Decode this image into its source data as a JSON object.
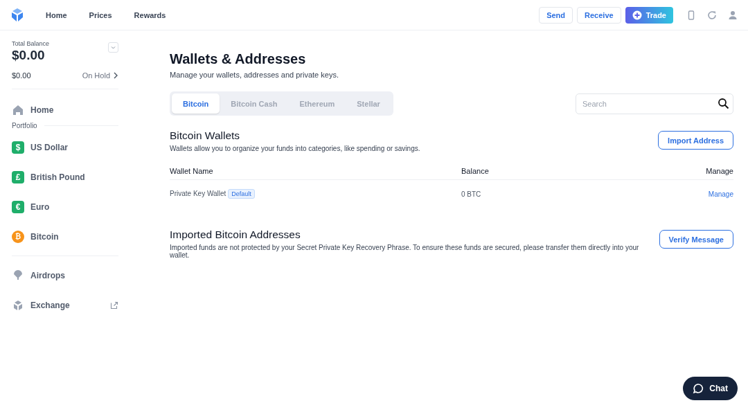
{
  "header": {
    "nav": [
      "Home",
      "Prices",
      "Rewards"
    ],
    "actions": [
      {
        "label": "Send",
        "kind": "outline"
      },
      {
        "label": "Receive",
        "kind": "outline"
      },
      {
        "label": "Trade",
        "kind": "primary"
      }
    ]
  },
  "sidebar": {
    "balance_label": "Total Balance",
    "balance": "$0.00",
    "available": "$0.00",
    "on_hold": "On Hold",
    "home": "Home",
    "section_label": "Portfolio",
    "portfolio": [
      {
        "label": "US Dollar",
        "glyph": "$",
        "color": "#1fae6a"
      },
      {
        "label": "British Pound",
        "glyph": "£",
        "color": "#1fae6a"
      },
      {
        "label": "Euro",
        "glyph": "€",
        "color": "#1fae6a"
      },
      {
        "label": "Bitcoin",
        "glyph": "₿",
        "color": "#f7931a"
      }
    ],
    "links": [
      {
        "label": "Airdrops",
        "kind": "airdrop"
      },
      {
        "label": "Exchange",
        "kind": "exchange"
      }
    ]
  },
  "page": {
    "title": "Wallets & Addresses",
    "subtitle": "Manage your wallets, addresses and private keys.",
    "tabs": [
      {
        "label": "Bitcoin",
        "selected": true
      },
      {
        "label": "Bitcoin Cash",
        "selected": false
      },
      {
        "label": "Ethereum",
        "selected": false
      },
      {
        "label": "Stellar",
        "selected": false
      }
    ],
    "search": {
      "placeholder": "Search"
    },
    "wallets": {
      "title": "Bitcoin Wallets",
      "description": "Wallets allow you to organize your funds into categories, like spending or savings.",
      "button": "Import Address",
      "columns": [
        "Wallet Name",
        "Balance",
        "Manage"
      ],
      "rows": [
        {
          "name": "Private Key Wallet",
          "badge": "Default",
          "balance": "0 BTC",
          "action": "Manage"
        }
      ]
    },
    "imported": {
      "title": "Imported Bitcoin Addresses",
      "description": "Imported funds are not protected by your Secret Private Key Recovery Phrase. To ensure these funds are secured, please transfer them directly into your wallet.",
      "button": "Verify Message"
    }
  },
  "chat": {
    "label": "Chat"
  }
}
